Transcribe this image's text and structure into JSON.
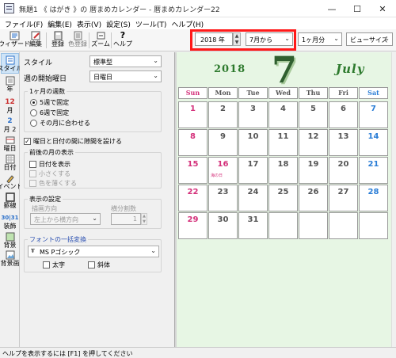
{
  "window": {
    "title": "無題1 《 はがき 》の 暦まめカレンダー - 暦まめカレンダー22",
    "min": "—",
    "max": "☐",
    "close": "✕"
  },
  "menu": [
    "ファイル(F)",
    "編集(E)",
    "表示(V)",
    "設定(S)",
    "ツール(T)",
    "ヘルプ(H)"
  ],
  "toolbar": {
    "wizard": "ウィザード",
    "edit": "編集",
    "register": "登録",
    "color_register": "色登録",
    "zoom": "ズーム",
    "help": "ヘルプ",
    "year": "2018 年",
    "month_from": "7月から",
    "months": "1ヶ月分",
    "view": "ビューサイズ"
  },
  "strip": [
    "スタイル",
    "年",
    "月",
    "月 2",
    "曜日",
    "日付",
    "イベント",
    "罫線",
    "装飾",
    "背景",
    "背景画"
  ],
  "panel": {
    "style_label": "スタイル",
    "style_value": "標準型",
    "week_start_label": "週の開始曜日",
    "week_start_value": "日曜日",
    "rows_group": "1ヶ月の週数",
    "rows_options": [
      "5週で固定",
      "6週で固定",
      "その月に合わせる"
    ],
    "rows_selected": 0,
    "gap_checkbox": "曜日と日付の間に隙間を設ける",
    "gap_checked": true,
    "adj_group": "前後の月の表示",
    "adj_show": "日付を表示",
    "adj_small": "小さくする",
    "adj_light": "色を薄くする",
    "display_group": "表示の設定",
    "direction_label": "描画方向",
    "direction_value": "左上から横方向",
    "split_label": "横分割数",
    "split_value": "1",
    "font_group": "フォントの一括変換",
    "font_value": "MS Pゴシック",
    "bold": "太字",
    "italic": "斜体"
  },
  "calendar": {
    "year": "2018",
    "month_num": "7",
    "month_name": "July",
    "weekdays": [
      "Sun",
      "Mon",
      "Tue",
      "Wed",
      "Thu",
      "Fri",
      "Sat"
    ],
    "weekday_colors": [
      "#d4307a",
      "#555555",
      "#555555",
      "#555555",
      "#555555",
      "#555555",
      "#2a7dd6"
    ],
    "weeks": [
      [
        "1",
        "2",
        "3",
        "4",
        "5",
        "6",
        "7"
      ],
      [
        "8",
        "9",
        "10",
        "11",
        "12",
        "13",
        "14"
      ],
      [
        "15",
        "16",
        "17",
        "18",
        "19",
        "20",
        "21"
      ],
      [
        "22",
        "23",
        "24",
        "25",
        "26",
        "27",
        "28"
      ],
      [
        "29",
        "30",
        "31",
        "",
        "",
        "",
        ""
      ]
    ],
    "holidays": [
      "16"
    ],
    "holiday_note": "海の日",
    "sun_color": "#d4307a",
    "sat_color": "#2a7dd6",
    "holiday_color": "#d4307a",
    "weekday_color": "#555555"
  },
  "status": "ヘルプを表示するには [F1] を押してください"
}
